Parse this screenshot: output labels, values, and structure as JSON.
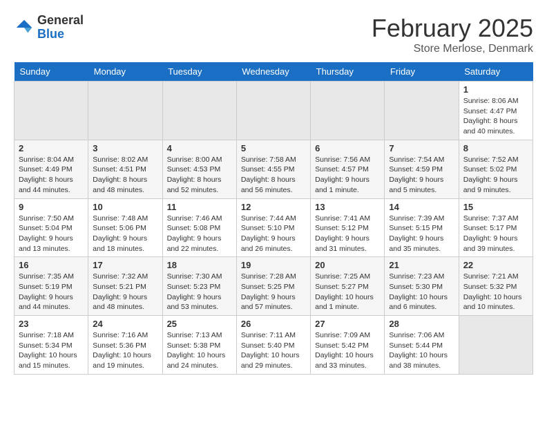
{
  "logo": {
    "general": "General",
    "blue": "Blue"
  },
  "title": "February 2025",
  "location": "Store Merlose, Denmark",
  "days_of_week": [
    "Sunday",
    "Monday",
    "Tuesday",
    "Wednesday",
    "Thursday",
    "Friday",
    "Saturday"
  ],
  "weeks": [
    [
      {
        "day": null,
        "info": null
      },
      {
        "day": null,
        "info": null
      },
      {
        "day": null,
        "info": null
      },
      {
        "day": null,
        "info": null
      },
      {
        "day": null,
        "info": null
      },
      {
        "day": null,
        "info": null
      },
      {
        "day": "1",
        "info": "Sunrise: 8:06 AM\nSunset: 4:47 PM\nDaylight: 8 hours and 40 minutes."
      }
    ],
    [
      {
        "day": "2",
        "info": "Sunrise: 8:04 AM\nSunset: 4:49 PM\nDaylight: 8 hours and 44 minutes."
      },
      {
        "day": "3",
        "info": "Sunrise: 8:02 AM\nSunset: 4:51 PM\nDaylight: 8 hours and 48 minutes."
      },
      {
        "day": "4",
        "info": "Sunrise: 8:00 AM\nSunset: 4:53 PM\nDaylight: 8 hours and 52 minutes."
      },
      {
        "day": "5",
        "info": "Sunrise: 7:58 AM\nSunset: 4:55 PM\nDaylight: 8 hours and 56 minutes."
      },
      {
        "day": "6",
        "info": "Sunrise: 7:56 AM\nSunset: 4:57 PM\nDaylight: 9 hours and 1 minute."
      },
      {
        "day": "7",
        "info": "Sunrise: 7:54 AM\nSunset: 4:59 PM\nDaylight: 9 hours and 5 minutes."
      },
      {
        "day": "8",
        "info": "Sunrise: 7:52 AM\nSunset: 5:02 PM\nDaylight: 9 hours and 9 minutes."
      }
    ],
    [
      {
        "day": "9",
        "info": "Sunrise: 7:50 AM\nSunset: 5:04 PM\nDaylight: 9 hours and 13 minutes."
      },
      {
        "day": "10",
        "info": "Sunrise: 7:48 AM\nSunset: 5:06 PM\nDaylight: 9 hours and 18 minutes."
      },
      {
        "day": "11",
        "info": "Sunrise: 7:46 AM\nSunset: 5:08 PM\nDaylight: 9 hours and 22 minutes."
      },
      {
        "day": "12",
        "info": "Sunrise: 7:44 AM\nSunset: 5:10 PM\nDaylight: 9 hours and 26 minutes."
      },
      {
        "day": "13",
        "info": "Sunrise: 7:41 AM\nSunset: 5:12 PM\nDaylight: 9 hours and 31 minutes."
      },
      {
        "day": "14",
        "info": "Sunrise: 7:39 AM\nSunset: 5:15 PM\nDaylight: 9 hours and 35 minutes."
      },
      {
        "day": "15",
        "info": "Sunrise: 7:37 AM\nSunset: 5:17 PM\nDaylight: 9 hours and 39 minutes."
      }
    ],
    [
      {
        "day": "16",
        "info": "Sunrise: 7:35 AM\nSunset: 5:19 PM\nDaylight: 9 hours and 44 minutes."
      },
      {
        "day": "17",
        "info": "Sunrise: 7:32 AM\nSunset: 5:21 PM\nDaylight: 9 hours and 48 minutes."
      },
      {
        "day": "18",
        "info": "Sunrise: 7:30 AM\nSunset: 5:23 PM\nDaylight: 9 hours and 53 minutes."
      },
      {
        "day": "19",
        "info": "Sunrise: 7:28 AM\nSunset: 5:25 PM\nDaylight: 9 hours and 57 minutes."
      },
      {
        "day": "20",
        "info": "Sunrise: 7:25 AM\nSunset: 5:27 PM\nDaylight: 10 hours and 1 minute."
      },
      {
        "day": "21",
        "info": "Sunrise: 7:23 AM\nSunset: 5:30 PM\nDaylight: 10 hours and 6 minutes."
      },
      {
        "day": "22",
        "info": "Sunrise: 7:21 AM\nSunset: 5:32 PM\nDaylight: 10 hours and 10 minutes."
      }
    ],
    [
      {
        "day": "23",
        "info": "Sunrise: 7:18 AM\nSunset: 5:34 PM\nDaylight: 10 hours and 15 minutes."
      },
      {
        "day": "24",
        "info": "Sunrise: 7:16 AM\nSunset: 5:36 PM\nDaylight: 10 hours and 19 minutes."
      },
      {
        "day": "25",
        "info": "Sunrise: 7:13 AM\nSunset: 5:38 PM\nDaylight: 10 hours and 24 minutes."
      },
      {
        "day": "26",
        "info": "Sunrise: 7:11 AM\nSunset: 5:40 PM\nDaylight: 10 hours and 29 minutes."
      },
      {
        "day": "27",
        "info": "Sunrise: 7:09 AM\nSunset: 5:42 PM\nDaylight: 10 hours and 33 minutes."
      },
      {
        "day": "28",
        "info": "Sunrise: 7:06 AM\nSunset: 5:44 PM\nDaylight: 10 hours and 38 minutes."
      },
      {
        "day": null,
        "info": null
      }
    ]
  ]
}
